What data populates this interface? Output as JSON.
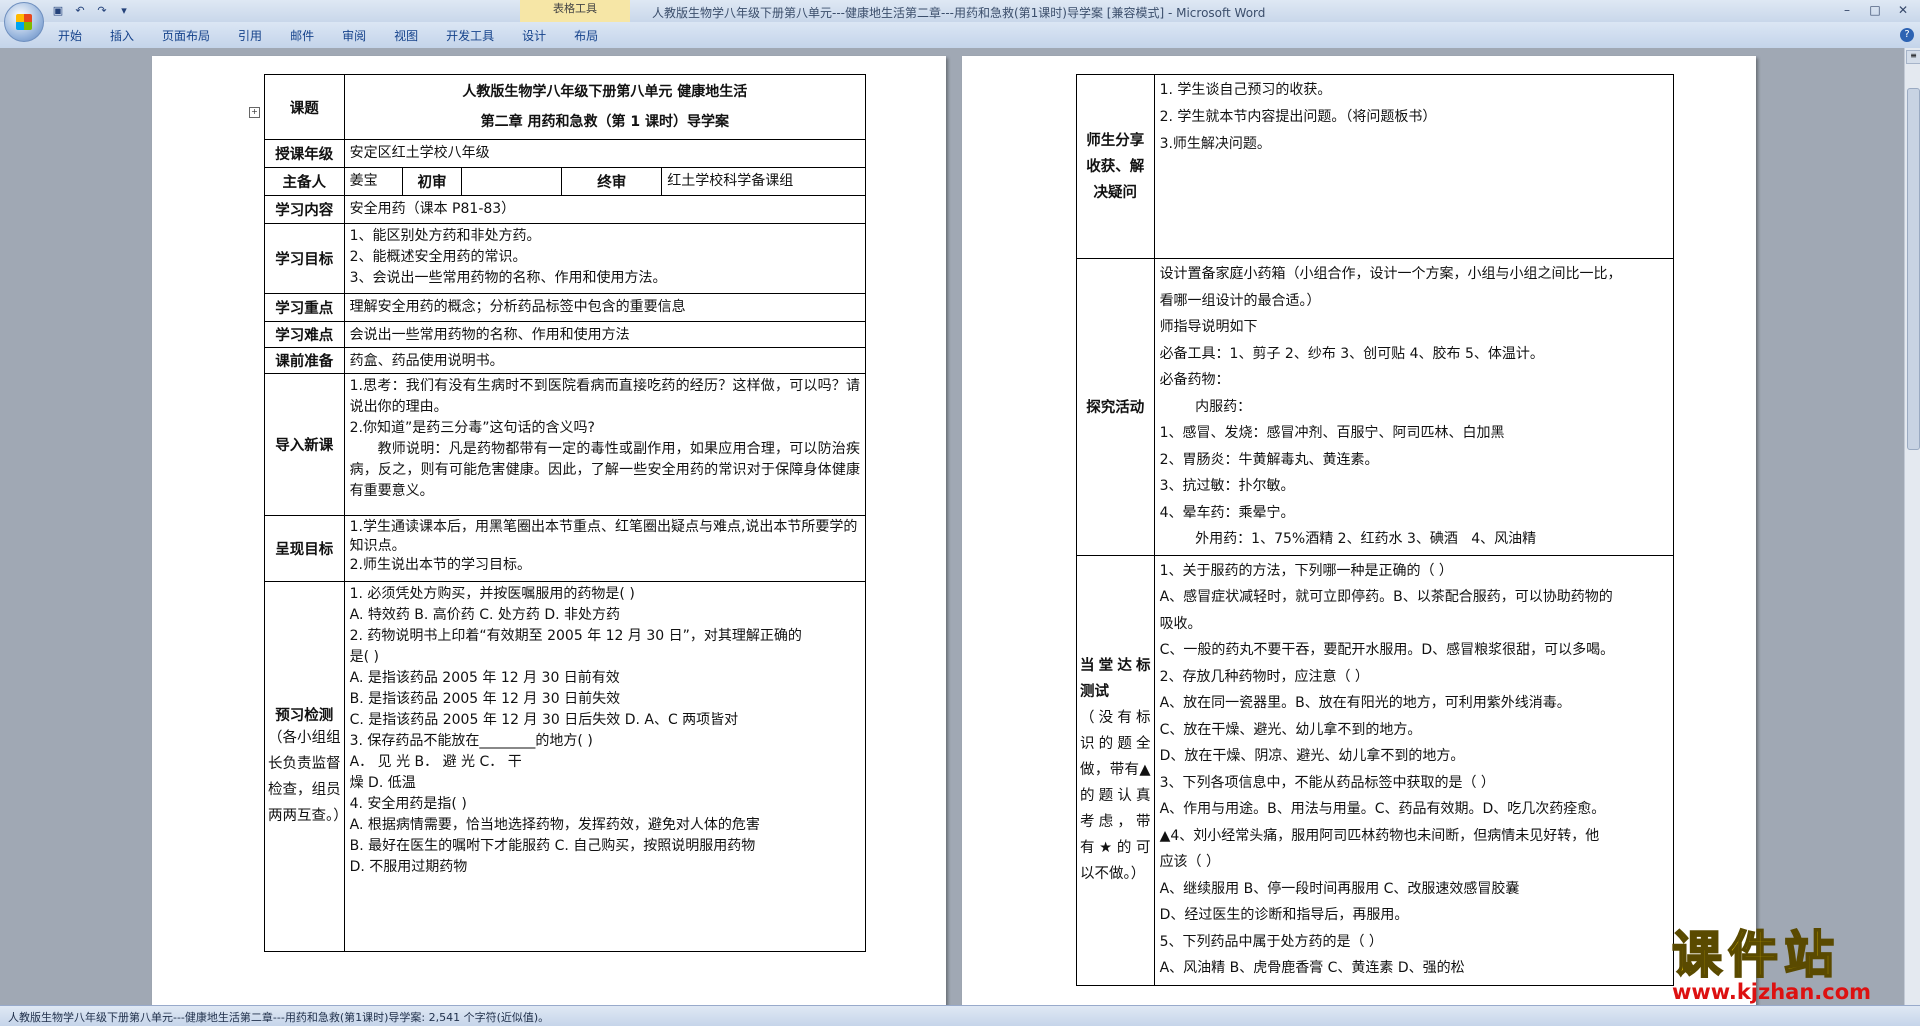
{
  "window": {
    "title": "人教版生物学八年级下册第八单元---健康地生活第二章---用药和急救(第1课时)导学案 [兼容模式] - Microsoft Word",
    "context_tab": "表格工具"
  },
  "ribbon": {
    "tabs": [
      "开始",
      "插入",
      "页面布局",
      "引用",
      "邮件",
      "审阅",
      "视图",
      "开发工具",
      "设计",
      "布局"
    ]
  },
  "status": {
    "text": "人教版生物学八年级下册第八单元---健康地生活第二章---用药和急救(第1课时)导学案: 2,541 个字符(近似值)。"
  },
  "left_table": {
    "title_label": "课题",
    "title_line1": "人教版生物学八年级下册第八单元      健康地生活",
    "title_line2": "第二章      用药和急救（第 1 课时）导学案",
    "grade_label": "授课年级",
    "grade_value": "安定区红土学校八年级",
    "prep_label": "主备人",
    "prep_value": "姜宝",
    "first_review_label": "初审",
    "first_review_value": "",
    "final_review_label": "终审",
    "final_review_value": "红土学校科学备课组",
    "content_label": "学习内容",
    "content_value": "安全用药（课本 P81-83）",
    "goal_label": "学习目标",
    "goals": [
      "1、能区别处方药和非处方药。",
      "2、能概述安全用药的常识。",
      "3、会说出一些常用药物的名称、作用和使用方法。"
    ],
    "key_label": "学习重点",
    "key_value": "理解安全用药的概念；分析药品标签中包含的重要信息",
    "difficulty_label": "学习难点",
    "difficulty_value": "会说出一些常用药物的名称、作用和使用方法",
    "prep2_label": "课前准备",
    "prep2_value": "药盒、药品使用说明书。",
    "intro_label": "导入新课",
    "intro_q1": "1.思考：我们有没有生病时不到医院看病而直接吃药的经历？这样做，可以吗？请说出你的理由。",
    "intro_q2": "2.你知道”是药三分毒”这句话的含义吗?",
    "intro_teacher": "教师说明：凡是药物都带有一定的毒性或副作用，如果应用合理，可以防治疾病，反之，则有可能危害健康。因此，了解一些安全用药的常识对于保障身体健康有重要意义。",
    "present_label": "呈现目标",
    "present_1": "1.学生通读课本后，用黑笔圈出本节重点、红笔圈出疑点与难点,说出本节所要学的知识点。",
    "present_2": "2.师生说出本节的学习目标。",
    "pre_label": "预习检测",
    "pre_sub": "（各小组组长负责监督检查，组员两两互查。）",
    "pre_lines": [
      "1. 必须凭处方购买，并按医嘱服用的药物是(          )",
      "A. 特效药              B. 高价药   C. 处方药              D. 非处方药",
      "2. 药物说明书上印着“有效期至 2005 年 12 月 30 日”，对其理解正确的",
      "是(          )",
      "A. 是指该药品 2005 年 12 月 30 日前有效",
      "B. 是指该药品 2005 年 12 月 30 日前失效",
      "C. 是指该药品 2005 年 12 月 30 日后失效            D.  A、C 两项皆对",
      "3. 保存药品不能放在________的地方(          )",
      "A． 见 光                          B． 避 光                        C． 干",
      "燥                       D. 低温",
      "4. 安全用药是指(          )",
      "A. 根据病情需要，恰当地选择药物，发挥药效，避免对人体的危害",
      "B. 最好在医生的嘱咐下才能服药          C. 自己购买，按照说明服用药物",
      "D. 不服用过期药物"
    ]
  },
  "right_table": {
    "share_label": "师生分享收获、解决疑问",
    "share_lines": [
      "1. 学生谈自己预习的收获。",
      "2. 学生就本节内容提出问题。（将问题板书）",
      "3.师生解决问题。"
    ],
    "explore_label": "探究活动",
    "explore_lines": [
      "设计置备家庭小药箱（小组合作，设计一个方案，小组与小组之间比一比，",
      "看哪一组设计的最合适。）",
      "师指导说明如下",
      "必备工具：1、剪子 2、纱布 3、创可贴      4、胶布 5、体温计。",
      "必备药物：",
      "        内服药：",
      "1、感冒、发烧：感冒冲剂、百服宁、阿司匹林、白加黑",
      "2、胃肠炎：牛黄解毒丸、黄连素。",
      "3、抗过敏：扑尔敏。",
      "4、晕车药：乘晕宁。",
      "        外用药：1、75%酒精 2、红药水 3、碘酒   4、风油精"
    ],
    "test_label": "当堂达标测试",
    "test_sub": "（没有标识的题全做，带有▲的题认真考虑，带有★的可以不做。）",
    "test_lines": [
      "1、关于服药的方法，下列哪一种是正确的（            ）",
      "A、感冒症状减轻时，就可立即停药。B、以茶配合服药，可以协助药物的",
      "吸收。",
      "C、一般的药丸不要干吞，要配开水服用。D、感冒粮浆很甜，可以多喝。",
      "2、存放几种药物时，应注意（            ）",
      "A、放在同一瓷器里。B、放在有阳光的地方，可利用紫外线消毒。",
      "C、放在干燥、避光、幼儿拿不到的地方。",
      "D、放在干燥、阴凉、避光、幼儿拿不到的地方。",
      "3、下列各项信息中，不能从药品标签中获取的是（            ）",
      "A、作用与用途。B、用法与用量。C、药品有效期。D、吃几次药痊愈。",
      "▲4、刘小经常头痛，服用阿司匹林药物也未间断，但病情未见好转，他",
      "应该（         ）",
      "A、继续服用 B、停一段时间再服用    C、改服速效感冒胶囊",
      "D、经过医生的诊断和指导后，再服用。",
      "5、下列药品中属于处方药的是（              ）",
      "A、风油精    B、虎骨鹿香膏    C、黄连素     D、强的松"
    ]
  },
  "watermark": {
    "main": "课件站",
    "url": "www.kjzhan.com"
  }
}
